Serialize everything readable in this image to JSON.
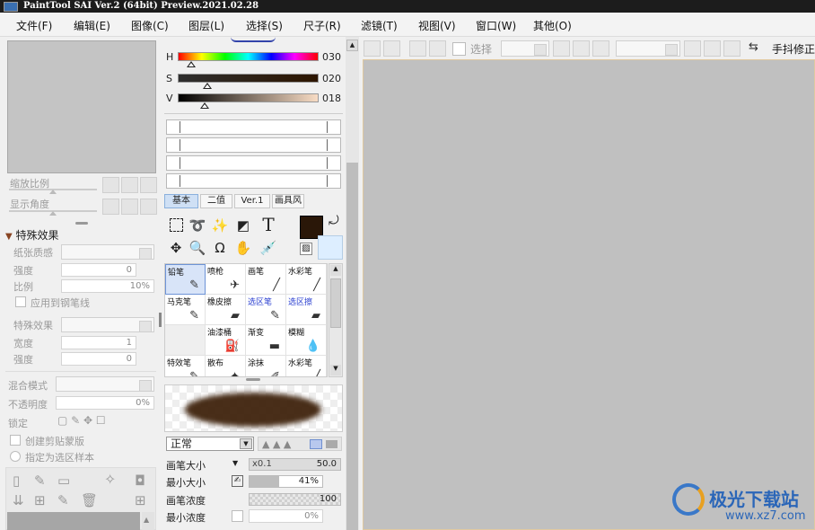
{
  "window": {
    "title": "PaintTool SAI Ver.2 (64bit) Preview.2021.02.28"
  },
  "menu": [
    "文件(F)",
    "编辑(E)",
    "图像(C)",
    "图层(L)",
    "选择(S)",
    "尺子(R)",
    "滤镜(T)",
    "视图(V)",
    "窗口(W)",
    "其他(O)"
  ],
  "navigator": {
    "zoom_label": "缩放比例",
    "angle_label": "显示角度"
  },
  "effects": {
    "section_title": "特殊效果",
    "paper_texture_label": "纸张质感",
    "strength_label": "强度",
    "strength_value": "0",
    "scale_label": "比例",
    "scale_value": "10%",
    "apply_to_pen_label": "应用到钢笔线",
    "effect_label": "特殊效果",
    "width_label": "宽度",
    "width_value": "1",
    "strength2_label": "强度",
    "strength2_value": "0"
  },
  "layer": {
    "blend_mode_label": "混合模式",
    "opacity_label": "不透明度",
    "opacity_value": "0%",
    "lock_label": "锁定",
    "clipping_label": "创建剪贴蒙版",
    "selection_source_label": "指定为选区样本"
  },
  "color": {
    "h_label": "H",
    "h_value": "030",
    "s_label": "S",
    "s_value": "020",
    "v_label": "V",
    "v_value": "018",
    "foreground": "#2a1708",
    "background": "#ddeeff"
  },
  "tool_tabs": [
    "基本",
    "二值",
    "Ver.1",
    "画具风"
  ],
  "brushes": [
    {
      "name": "铅笔",
      "icon": "✎"
    },
    {
      "name": "喷枪",
      "icon": "✈"
    },
    {
      "name": "画笔",
      "icon": "╱"
    },
    {
      "name": "水彩笔",
      "icon": "╱"
    },
    {
      "name": "马克笔",
      "icon": "✎"
    },
    {
      "name": "橡皮擦",
      "icon": "▰"
    },
    {
      "name": "选区笔",
      "icon": "✎"
    },
    {
      "name": "选区擦",
      "icon": "▰"
    },
    {
      "name": "",
      "icon": ""
    },
    {
      "name": "油漆桶",
      "icon": "⛽"
    },
    {
      "name": "渐变",
      "icon": "▬"
    },
    {
      "name": "模糊",
      "icon": "💧"
    },
    {
      "name": "特效笔",
      "icon": "✎"
    },
    {
      "name": "散布",
      "icon": "✦"
    },
    {
      "name": "涂抹",
      "icon": "✐"
    },
    {
      "name": "水彩笔",
      "icon": "╱"
    }
  ],
  "brush_settings": {
    "mode": "正常",
    "size_label": "画笔大小",
    "size_multiplier": "x0.1",
    "size_value": "50.0",
    "min_size_label": "最小大小",
    "min_size_value": "41%",
    "min_size_level": 0.41,
    "density_label": "画笔浓度",
    "density_value": "100",
    "min_density_label": "最小浓度",
    "min_density_value": "0%"
  },
  "toolbar2": {
    "select_label": "选择",
    "stabilizer_label": "手抖修正"
  },
  "watermark": {
    "text": "极光下载站",
    "url": "www.xz7.com"
  }
}
